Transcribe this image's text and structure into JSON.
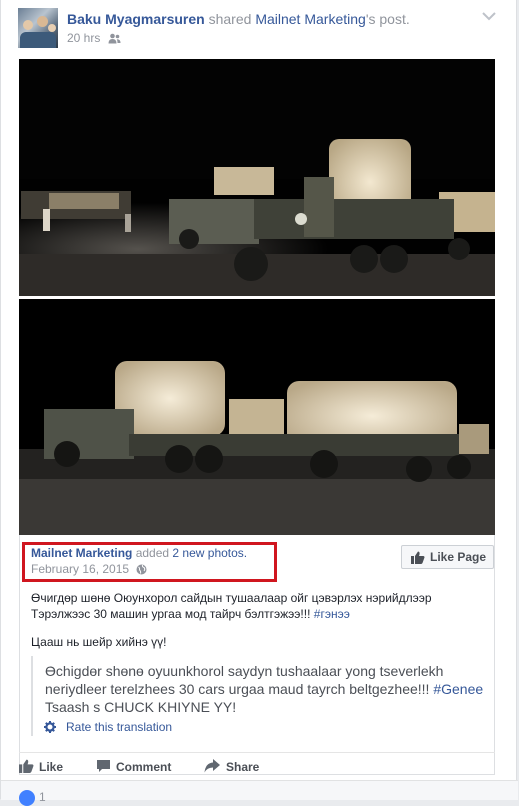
{
  "post": {
    "author": "Baku Myagmarsuren",
    "shared_text": "shared",
    "source_page": "Mailnet Marketing",
    "source_suffix": "'s post.",
    "time": "20 hrs",
    "audience_icon": "friends-icon"
  },
  "shared_post": {
    "page_name": "Mailnet Marketing",
    "added_text": "added",
    "photos_link": "2 new photos.",
    "date": "February 16, 2015",
    "like_page_label": "Like Page",
    "text_line1": "Өчигдөр шөнө Оюунхорол сайдын тушаалаар ойг цэвэрлэх нэрийдлээр",
    "text_line2_prefix": "Тэрэлжээс 30 машин ургаа мод тайрч бэлтгэжээ!!! ",
    "hashtag": "#гэнээ",
    "text_line3": "Цааш нь шейр хийнэ үү!",
    "translation": {
      "line1": "Өchigdөr shөnө oyuunkhorol saydyn tushaalaar yong tseverlekh",
      "line2_prefix": "neriydleer terelzhees 30 cars urgaa maud tayrch beltgezhee!!! ",
      "hashtag": "#Genee",
      "line3": "Tsaash s CHUCK KHIYNE YY!",
      "rate_label": "Rate this translation"
    }
  },
  "actions": {
    "like": "Like",
    "comment": "Comment",
    "share": "Share"
  },
  "reactions": {
    "count": "1"
  },
  "colors": {
    "link": "#365899",
    "highlight_box": "#d0161f",
    "muted": "#90949c"
  }
}
